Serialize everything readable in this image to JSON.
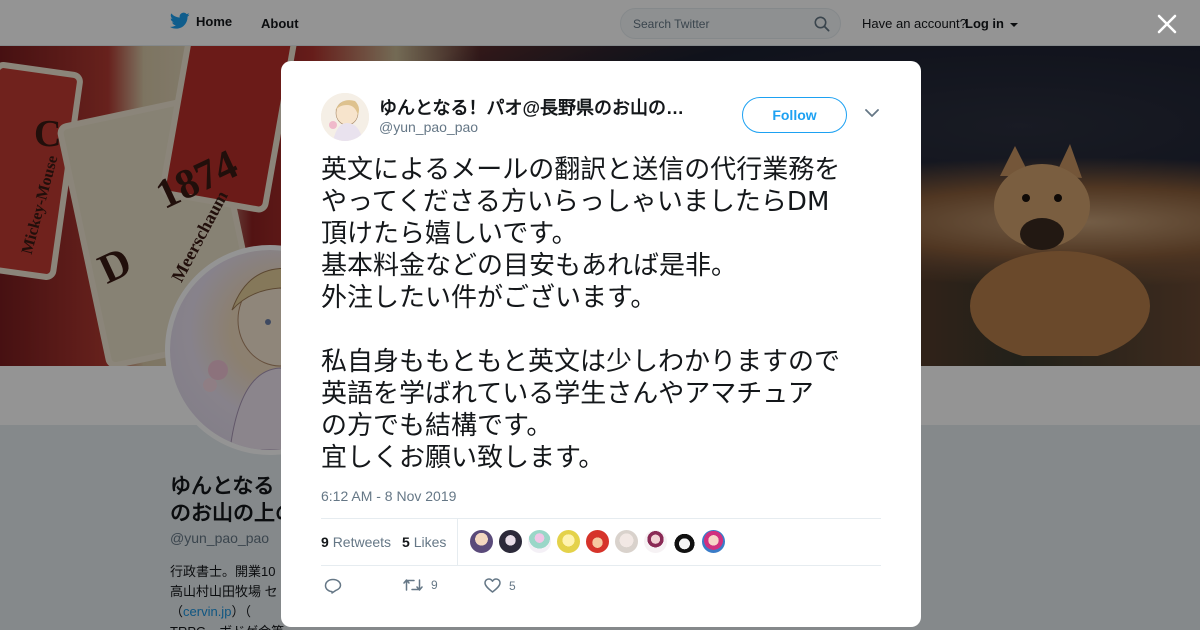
{
  "nav": {
    "home_label": "Home",
    "about_label": "About",
    "search_placeholder": "Search Twitter",
    "have_account": "Have an account?",
    "login_label": "Log in"
  },
  "banner": {
    "card_labels": [
      "C",
      "1874",
      "D",
      "Meerschaum",
      "Mickey-Mouse"
    ]
  },
  "profile": {
    "name_line1": "ゆんとなる",
    "name_line2": "のお山の上の",
    "handle": "@yun_pao_pao",
    "bio_line1": "行政書士。開業10",
    "bio_line2": "高山村山田牧場 セ",
    "bio_link": "cervin.jp",
    "bio_line4": "TRPG　ボドゲ会等"
  },
  "tweet": {
    "author_name": "ゆんとなる！パオ@長野県のお山の…",
    "author_handle": "@yun_pao_pao",
    "follow_label": "Follow",
    "text": "英文によるメールの翻訳と送信の代行業務を\nやってくださる方いらっしゃいましたらDM\n頂けたら嬉しいです。\n基本料金などの目安もあれば是非。\n外注したい件がございます。\n\n私自身ももともと英文は少しわかりますので\n英語を学ばれている学生さんやアマチュア\nの方でも結構です。\n宜しくお願い致します。",
    "timestamp": "6:12 AM - 8 Nov 2019",
    "retweets_count": "9",
    "retweets_label": "Retweets",
    "likes_count": "5",
    "likes_label": "Likes",
    "action_retweet_count": "9",
    "action_like_count": "5"
  },
  "colors": {
    "accent": "#1da1f2",
    "muted": "#657786",
    "text": "#14171a"
  },
  "icons": [
    "twitter-bird-icon",
    "search-icon",
    "caret-down-icon",
    "close-icon",
    "reply-icon",
    "retweet-icon",
    "heart-icon"
  ]
}
